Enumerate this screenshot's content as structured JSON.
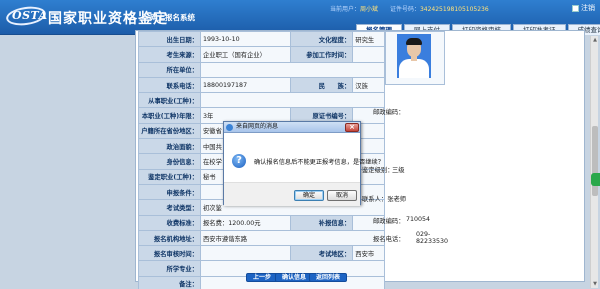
{
  "header": {
    "logo_text": "OSTA",
    "site_title": "国家职业资格鉴定",
    "site_subtitle": "网上报名系统",
    "user_label": "当前用户：",
    "user_value": "周小斌",
    "cert_label": "证件号码：",
    "cert_value": "342425198105105236",
    "logout": "注销"
  },
  "tabs": [
    "报名管理",
    "网上支付",
    "打印资格审核",
    "打印准考证",
    "成绩查询"
  ],
  "form": {
    "birth_date": {
      "label": "出生日期：",
      "value": "1993-10-10"
    },
    "education": {
      "label": "文化程度：",
      "value": "研究生"
    },
    "examinee_source": {
      "label": "考生来源：",
      "value": "企业职工（国有企业）"
    },
    "work_start": {
      "label": "参加工作时间：",
      "value": ""
    },
    "unit": {
      "label": "所在单位：",
      "value": ""
    },
    "phone": {
      "label": "联系电话：",
      "value": "18800197187"
    },
    "ethnicity": {
      "label": "民　　族：",
      "value": "汉族"
    },
    "occupation": {
      "label": "从事职业(工种)：",
      "value": ""
    },
    "occupation_years": {
      "label": "本职业(工种)年限：",
      "value": "3年"
    },
    "original_cert_no": {
      "label": "原证书编号：",
      "value": ""
    },
    "hukou": {
      "label": "户籍所在省份地区：",
      "value": "安徽省"
    },
    "political": {
      "label": "政治面貌：",
      "value": "中国共"
    },
    "id_type": {
      "label": "身份信息：",
      "value": "在校学"
    },
    "declared_occupation": {
      "label": "鉴定职业(工种)：",
      "value": "秘书"
    },
    "declare_condition": {
      "label": "申报条件：",
      "value": ""
    },
    "exam_type": {
      "label": "考试类型：",
      "value": "初次鉴"
    },
    "fee_standard": {
      "label": "收费标准：",
      "value": "报名费：1200.00元"
    },
    "supplement": {
      "label": "补报信息：",
      "value": ""
    },
    "reg_agency": {
      "label": "报名机构地址：",
      "value": "西安市遵谐东路"
    },
    "review_time": {
      "label": "报名审核时间：",
      "value": ""
    },
    "exam_area": {
      "label": "考试地区：",
      "value": "西安市"
    },
    "school_major": {
      "label": "所学专业：",
      "value": ""
    },
    "remark": {
      "label": "备注：",
      "value": ""
    }
  },
  "right": {
    "postcode1": "邮政编码：",
    "level_label": "鉴定级别：",
    "level_value": "三级",
    "contact": "联系人：张老师",
    "postcode2_label": "邮政编码：",
    "postcode2_value": "710054",
    "reg_phone_label": "报名电话：",
    "reg_phone_value": "029-82233530"
  },
  "buttons": {
    "prev": "上一步",
    "confirm": "确认信息",
    "back": "返回列表"
  },
  "dialog": {
    "title": "来自网页的消息",
    "close": "×",
    "message": "确认报名信息后不能更正报考信息，是否继续？",
    "ok": "确定",
    "cancel": "取消"
  }
}
